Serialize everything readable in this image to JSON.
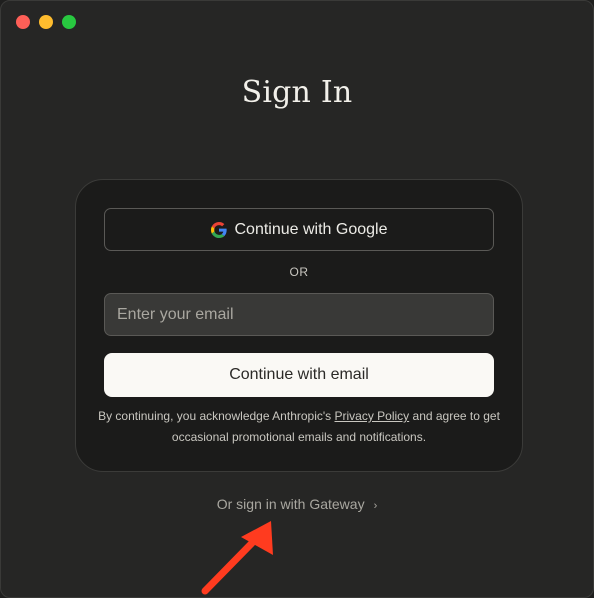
{
  "window": {
    "controls": [
      "close",
      "minimize",
      "zoom"
    ]
  },
  "page": {
    "title": "Sign In"
  },
  "card": {
    "google_button_label": "Continue with Google",
    "divider_text": "OR",
    "email_placeholder": "Enter your email",
    "email_value": "",
    "email_button_label": "Continue with email",
    "legal_prefix": "By continuing, you acknowledge Anthropic's ",
    "privacy_link": "Privacy Policy",
    "legal_suffix": " and agree to get occasional promotional emails and notifications."
  },
  "footer": {
    "gateway_link": "Or sign in with Gateway",
    "gateway_chevron": "›"
  },
  "icons": {
    "google": "google-icon",
    "annotation_arrow": "arrow-icon"
  },
  "colors": {
    "background": "#262625",
    "card": "#1b1b1a",
    "primary_button": "#faf9f5",
    "annotation_arrow": "#ff3b1f"
  }
}
